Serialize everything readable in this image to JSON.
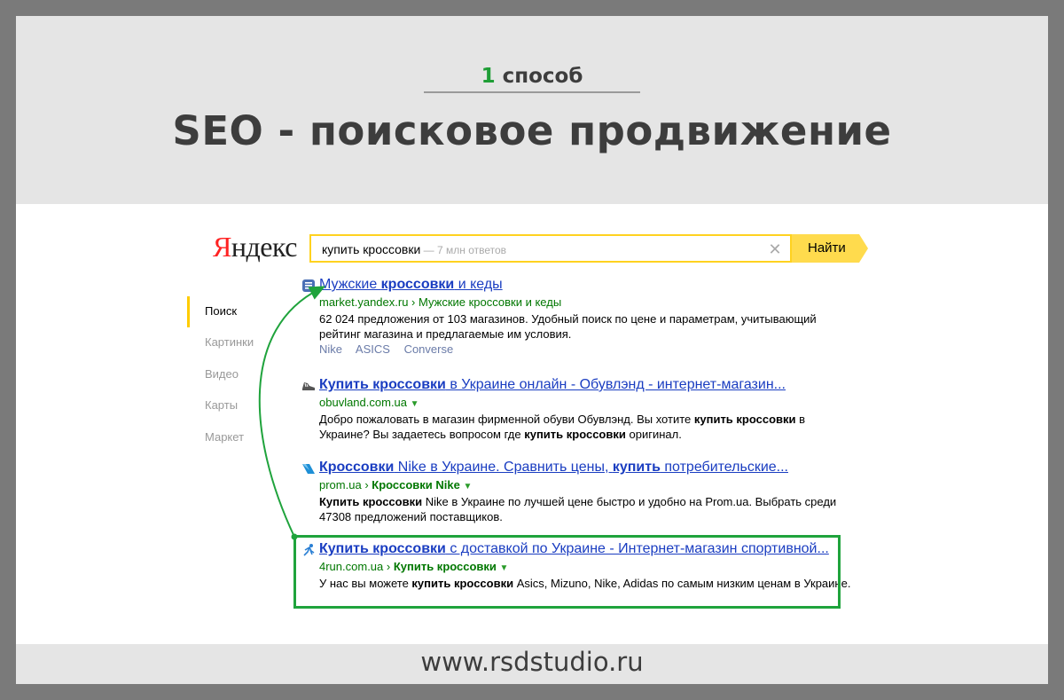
{
  "header": {
    "subtitle_num": "1",
    "subtitle_word": "способ",
    "title": "SEO - поисковое продвижение"
  },
  "footer": {
    "site": "www.rsdstudio.ru"
  },
  "serp": {
    "logo_first": "Я",
    "logo_rest": "ндекс",
    "query": "купить кроссовки",
    "count": " — 7 млн ответов",
    "find_label": "Найти",
    "nav": [
      "Поиск",
      "Картинки",
      "Видео",
      "Карты",
      "Маркет"
    ],
    "results": [
      {
        "title_parts": [
          "Мужские ",
          "кроссовки",
          " и кеды"
        ],
        "url": "market.yandex.ru",
        "crumb": "Мужские кроссовки и кеды",
        "text_html": "62 024 предложения от 103 магазинов. Удобный поиск по цене и параметрам, учитывающий рейтинг магазина и предлагаемые им условия.",
        "links": [
          "Nike",
          "ASICS",
          "Converse"
        ]
      },
      {
        "title_parts": [
          "Купить кроссовки",
          " в Украине онлайн - Обувлэнд - интернет-магазин..."
        ],
        "url": "obuvland.com.ua",
        "crumb": "",
        "text_html": "Добро пожаловать в магазин фирменной обуви Обувлэнд. Вы хотите <b>купить кроссовки</b> в Украине? Вы задаетесь вопросом где <b>купить кроссовки</b> оригинал."
      },
      {
        "title_parts": [
          "Кроссовки",
          " Nike в Украине. Сравнить цены, ",
          "купить",
          " потребительские..."
        ],
        "url": "prom.ua",
        "crumb": "Кроссовки Nike",
        "text_html": "<b>Купить кроссовки</b> Nike в Украине по лучшей цене быстро и удобно на Prom.ua. Выбрать среди 47308 предложений поставщиков."
      },
      {
        "title_parts": [
          "Купить кроссовки",
          " с доставкой по Украине - Интернет-магазин спортивной..."
        ],
        "url": "4run.com.ua",
        "crumb": "Купить кроссовки",
        "text_html": "У нас вы можете <b>купить кроссовки</b> Asics, Mizuno, Nike, Adidas по самым низким ценам в Украине."
      }
    ]
  },
  "colors": {
    "accent_green": "#1fa33c",
    "link_blue": "#1a3dc1",
    "url_green": "#007700",
    "yandex_yellow": "#ffdb4d"
  }
}
